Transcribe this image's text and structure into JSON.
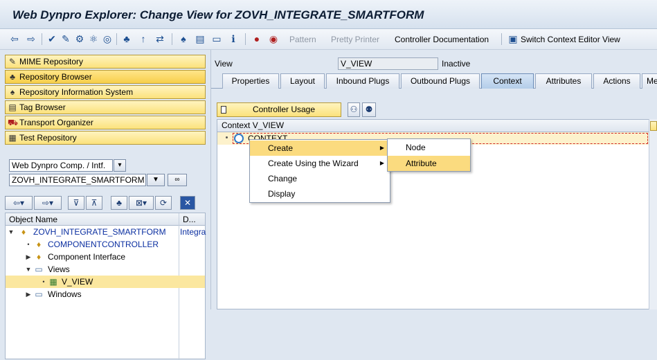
{
  "window": {
    "title": "Web Dynpro Explorer: Change View for ZOVH_INTEGRATE_SMARTFORM"
  },
  "toolbar": {
    "pattern": "Pattern",
    "pretty_printer": "Pretty Printer",
    "controller_documentation": "Controller Documentation",
    "switch_context_editor": "Switch Context Editor View"
  },
  "nav": {
    "items": [
      {
        "label": "MIME Repository"
      },
      {
        "label": "Repository Browser"
      },
      {
        "label": "Repository Information System"
      },
      {
        "label": "Tag Browser"
      },
      {
        "label": "Transport Organizer"
      },
      {
        "label": "Test Repository"
      }
    ]
  },
  "object_selector": {
    "type_value": "Web Dynpro Comp. / Intf.",
    "name_value": "ZOVH_INTEGRATE_SMARTFORM"
  },
  "object_tree": {
    "col_name": "Object Name",
    "col_desc": "D...",
    "rows": [
      {
        "label": "ZOVH_INTEGRATE_SMARTFORM",
        "desc": "Integra"
      },
      {
        "label": "COMPONENTCONTROLLER"
      },
      {
        "label": "Component Interface"
      },
      {
        "label": "Views"
      },
      {
        "label": "V_VIEW"
      },
      {
        "label": "Windows"
      }
    ]
  },
  "view_header": {
    "label": "View",
    "value": "V_VIEW",
    "status": "Inactive"
  },
  "tabs": [
    {
      "label": "Properties"
    },
    {
      "label": "Layout"
    },
    {
      "label": "Inbound Plugs"
    },
    {
      "label": "Outbound Plugs"
    },
    {
      "label": "Context"
    },
    {
      "label": "Attributes"
    },
    {
      "label": "Actions"
    },
    {
      "label": "Me"
    }
  ],
  "context_panel": {
    "controller_usage": "Controller Usage",
    "tree_title": "Context V_VIEW",
    "root_node": "CONTEXT"
  },
  "context_menu": {
    "items": [
      {
        "label": "Create"
      },
      {
        "label": "Create Using the Wizard"
      },
      {
        "label": "Change"
      },
      {
        "label": "Display"
      }
    ]
  },
  "submenu": {
    "items": [
      {
        "label": "Node"
      },
      {
        "label": "Attribute"
      }
    ]
  },
  "colors": {
    "highlight": "#fbdb7f",
    "nav_button": "#fbe27c",
    "active_tab": "#b4cde9"
  }
}
